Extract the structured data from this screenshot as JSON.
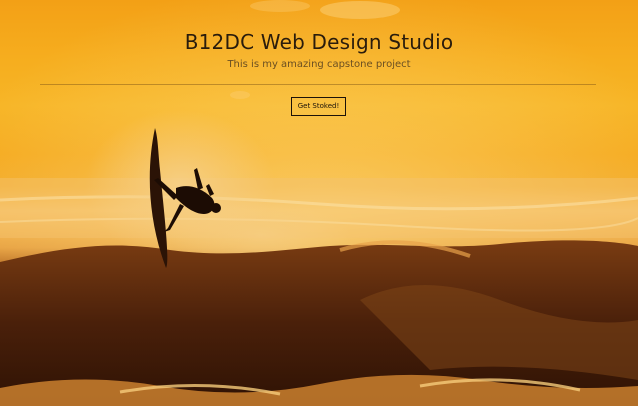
{
  "header": {
    "title": "B12DC Web Design Studio",
    "subtitle": "This is my amazing capstone project",
    "cta_label": "Get Stoked!"
  },
  "hero": {
    "image_subject": "surfer-silhouette-on-wave-at-sunset"
  },
  "colors": {
    "sky": "#f6ad1e",
    "wave_dark": "#3a1806",
    "text": "#2a1c0c"
  }
}
